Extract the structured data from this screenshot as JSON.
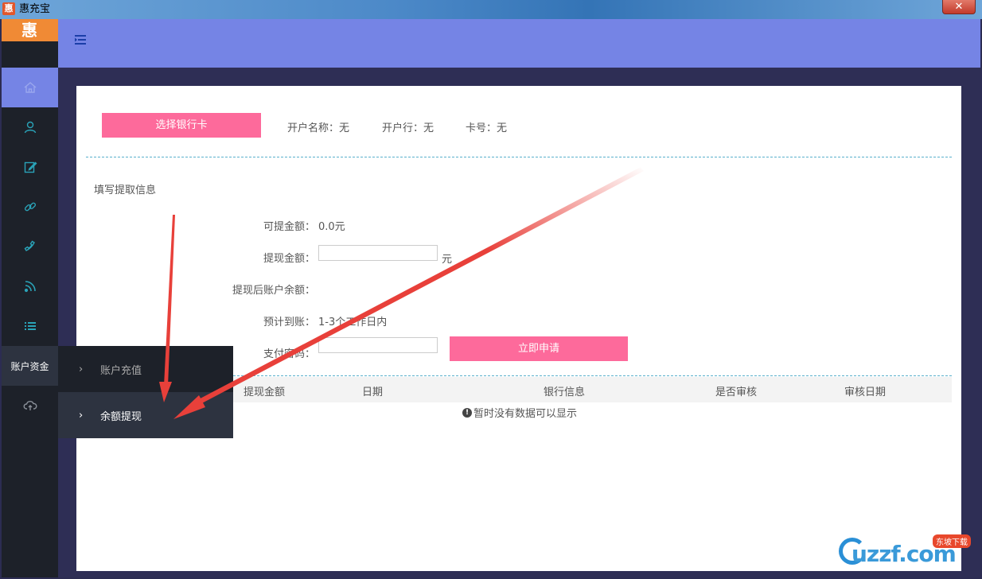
{
  "window": {
    "title": "惠充宝",
    "app_icon_text": "惠",
    "close_symbol": "✕"
  },
  "logo": {
    "text": "惠"
  },
  "sidebar": {
    "items": [
      {
        "icon": "home-icon"
      },
      {
        "icon": "user-icon"
      },
      {
        "icon": "edit-icon"
      },
      {
        "icon": "link-icon"
      },
      {
        "icon": "phone-icon"
      },
      {
        "icon": "rss-icon"
      },
      {
        "icon": "list-icon"
      },
      {
        "label": "账户资金"
      },
      {
        "icon": "cloud-upload-icon"
      }
    ]
  },
  "submenu": {
    "items": [
      {
        "label": "账户充值"
      },
      {
        "label": "余额提现"
      }
    ]
  },
  "bank": {
    "select_button": "选择银行卡",
    "account_name": "开户名称：无",
    "bank_name": "开户行：无",
    "card_no": "卡号：无"
  },
  "form": {
    "section_title": "填写提取信息",
    "available_label": "可提金额：",
    "available_value": "0.0元",
    "amount_label": "提现金额：",
    "amount_unit": "元",
    "balance_after_label": "提现后账户余额：",
    "eta_label": "预计到账：",
    "eta_value": "1-3个工作日内",
    "password_label": "支付密码：",
    "apply_button": "立即申请"
  },
  "table": {
    "columns": [
      "提现金额",
      "日期",
      "银行信息",
      "是否审核",
      "审核日期"
    ],
    "empty_message": "暂时没有数据可以显示"
  },
  "watermark": {
    "main": "uzzf.com",
    "badge": "东坡下载"
  },
  "colors": {
    "header": "#7584e5",
    "sidebar": "#1d2129",
    "accent_pink": "#fd6a9b",
    "logo_orange": "#f08a35",
    "arrow_red": "#e8403a"
  }
}
